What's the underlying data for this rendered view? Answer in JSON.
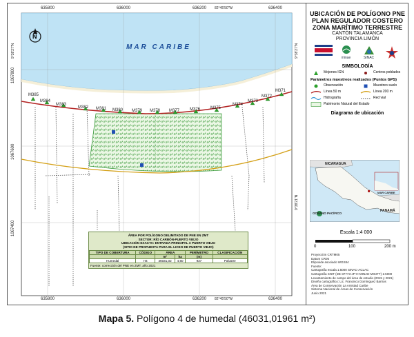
{
  "map": {
    "sea_label": "MAR CARIBE",
    "north_symbol": "N",
    "top_ticks": [
      "635800",
      "636000",
      "636200",
      "82°45'50\"W",
      "636400"
    ],
    "bottom_ticks": [
      "635800",
      "636000",
      "636200",
      "82°45'50\"W",
      "636400"
    ],
    "left_ticks": [
      "9°38'27\"N",
      "1067800",
      "1067600",
      "1067400"
    ],
    "right_ticks": [
      "9°38'27\"N",
      "9°38'21\"N"
    ],
    "markers": [
      "M385",
      "M384",
      "M383",
      "M382",
      "M381",
      "M380",
      "M379",
      "M378",
      "M377",
      "M376",
      "M375",
      "M374",
      "M373",
      "M372",
      "M371"
    ],
    "colors": {
      "sea": "#bfe3f5",
      "wetland": "#4caf50",
      "line50": "#b22222",
      "line200": "#d4a017"
    }
  },
  "table": {
    "line1": "ÁREA POR POLÍGONO DELIMITADO DE PNE EN ZMT",
    "line2": "SECTOR: RÍO CARBÓN-PUERTO VIEJO",
    "line3": "UBICACIÓN EXACTA: ENTRADA PRINCIPAL A PUERTO VIEJO",
    "line4": "(SITIO DE PROPUESTA PARA EL LICEO DE PUERTO VIEJO)",
    "headers": [
      "TIPO DE COBERTURA",
      "CÓDIGO",
      "ÁREA",
      "",
      "PERÍMETRO",
      "CLASIFICACIÓN"
    ],
    "subheaders": [
      "",
      "",
      "m²",
      "ha",
      "(m)",
      ""
    ],
    "row": [
      "Humedal",
      "H4",
      "46031,02",
      "4,60",
      "937",
      "Palustre"
    ],
    "source": "Fuente: corrección del PNE en ZMT, año 2021"
  },
  "panel": {
    "title1": "UBICACIÓN DE POLÍGONO PNE",
    "title2": "PLAN REGULADOR COSTERO",
    "title3": "ZONA MARÍTIMO TERRESTRE",
    "sub1": "CANTÓN TALAMANCA",
    "sub2": "PROVINCIA LIMÓN",
    "logo1": "minae",
    "logo2": "SINAC",
    "simbologia": "SIMBOLOGÍA",
    "leg_mojones": "Mojones IGN",
    "leg_centros": "Centros poblados",
    "leg_head": "Parámetros muestreos realizados (Puntos GPS)",
    "leg_obs": "Observación",
    "leg_suelo": "Muestreo suelo",
    "leg_l50": "Línea 50 m",
    "leg_l200": "Línea 200 m",
    "leg_hidro": "Hidrografía",
    "leg_vial": "Red vial",
    "leg_pne": "Patrimonio Natural del Estado",
    "diag_title": "Diagrama de ubicación",
    "diag_labels": {
      "nicaragua": "NICARAGUA",
      "panama": "PANAMÁ",
      "oceano": "OCÉANO PACÍFICO",
      "mar": "MAR CARIBE"
    },
    "scale_title": "Escala    1:4 000",
    "scale_labels": [
      "0",
      "100",
      "200 m"
    ],
    "meta": [
      "Proyección CRTM05",
      "Datum CR05",
      "Elipsoide asociado WGS84",
      "Fuente:",
      "Cartografía escala 1:5000 SINAC-ACLAC",
      "Cartografía SNIT (DE-37773-JP-H-MINAE-MICITT) 1:5000",
      "Levantamiento de campo del área de estudio (2015 y 2021)",
      "Diseño cartográfico: Lic. Francisco Domínguez Barrios",
      "Área de Conservación La Amistad Caribe",
      "Sistema Nacional de Áreas de Conservación",
      "Junio 2021"
    ]
  },
  "caption": {
    "label": "Mapa 5.",
    "text": " Polígono 4 de humedal (46031,01961 m²)"
  }
}
